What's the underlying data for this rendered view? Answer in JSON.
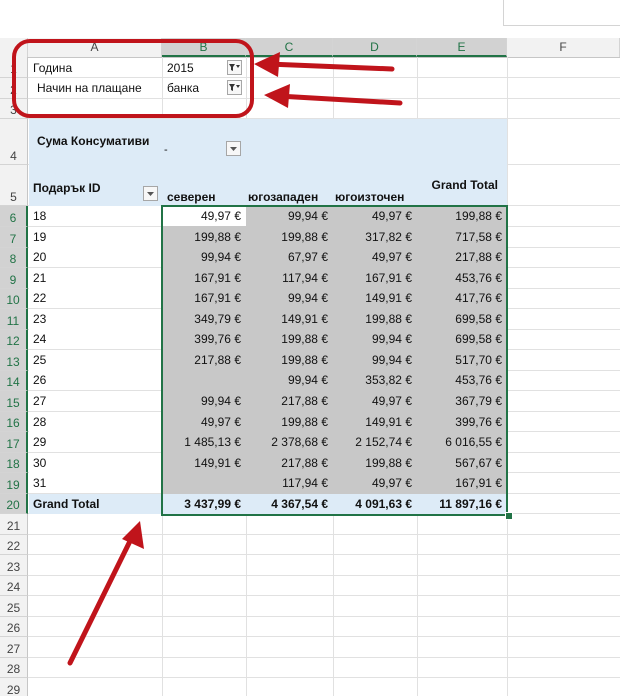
{
  "columns": [
    "A",
    "B",
    "C",
    "D",
    "E",
    "F"
  ],
  "rows": [
    "1",
    "2",
    "3",
    "4",
    "5",
    "6",
    "7",
    "8",
    "9",
    "10",
    "11",
    "12",
    "13",
    "14",
    "15",
    "16",
    "17",
    "18",
    "19",
    "20",
    "21",
    "22",
    "23",
    "24",
    "25",
    "26",
    "27",
    "28",
    "29"
  ],
  "filters": [
    {
      "label": "Година",
      "value": "2015"
    },
    {
      "label": "Начин на плащане",
      "value": "банка"
    }
  ],
  "pivot": {
    "values_label": "Сума Консумативи",
    "values_dash": "-",
    "row_field": "Подарък ID",
    "col_headers": [
      "северен",
      "югозападен",
      "югоизточен"
    ],
    "grand_total_header": "Grand Total",
    "rows": [
      {
        "id": "18",
        "v": [
          "49,97 €",
          "99,94 €",
          "49,97 €"
        ],
        "total": "199,88 €"
      },
      {
        "id": "19",
        "v": [
          "199,88 €",
          "199,88 €",
          "317,82 €"
        ],
        "total": "717,58 €"
      },
      {
        "id": "20",
        "v": [
          "99,94 €",
          "67,97 €",
          "49,97 €"
        ],
        "total": "217,88 €"
      },
      {
        "id": "21",
        "v": [
          "167,91 €",
          "117,94 €",
          "167,91 €"
        ],
        "total": "453,76 €"
      },
      {
        "id": "22",
        "v": [
          "167,91 €",
          "99,94 €",
          "149,91 €"
        ],
        "total": "417,76 €"
      },
      {
        "id": "23",
        "v": [
          "349,79 €",
          "149,91 €",
          "199,88 €"
        ],
        "total": "699,58 €"
      },
      {
        "id": "24",
        "v": [
          "399,76 €",
          "199,88 €",
          "99,94 €"
        ],
        "total": "699,58 €"
      },
      {
        "id": "25",
        "v": [
          "217,88 €",
          "199,88 €",
          "99,94 €"
        ],
        "total": "517,70 €"
      },
      {
        "id": "26",
        "v": [
          "",
          "99,94 €",
          "353,82 €"
        ],
        "total": "453,76 €"
      },
      {
        "id": "27",
        "v": [
          "99,94 €",
          "217,88 €",
          "49,97 €"
        ],
        "total": "367,79 €"
      },
      {
        "id": "28",
        "v": [
          "49,97 €",
          "199,88 €",
          "149,91 €"
        ],
        "total": "399,76 €"
      },
      {
        "id": "29",
        "v": [
          "1 485,13 €",
          "2 378,68 €",
          "2 152,74 €"
        ],
        "total": "6 016,55 €"
      },
      {
        "id": "30",
        "v": [
          "149,91 €",
          "217,88 €",
          "199,88 €"
        ],
        "total": "567,67 €"
      },
      {
        "id": "31",
        "v": [
          "",
          "117,94 €",
          "49,97 €"
        ],
        "total": "167,91 €"
      }
    ],
    "grand_total": {
      "label": "Grand Total",
      "v": [
        "3 437,99 €",
        "4 367,54 €",
        "4 091,63 €"
      ],
      "total": "11 897,16 €"
    }
  },
  "colors": {
    "accent": "#217346",
    "annotation": "#c0141b",
    "pivot_header": "#ddebf7",
    "selected_fill": "#c8c8c8"
  },
  "icons": {
    "filter_button": "filter-funnel-icon",
    "dropdown_button": "chevron-down-icon"
  }
}
